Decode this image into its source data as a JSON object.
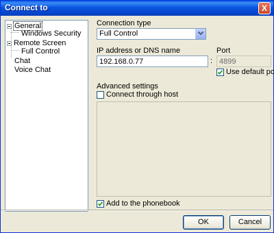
{
  "window": {
    "title": "Connect to",
    "close_glyph": "X"
  },
  "tree": {
    "items": [
      {
        "label": "General",
        "expanded": true,
        "selected": true
      },
      {
        "label": "Windows Security",
        "child": true
      },
      {
        "label": "Remote Screen",
        "expanded": true
      },
      {
        "label": "Full Control",
        "child": true
      },
      {
        "label": "Chat"
      },
      {
        "label": "Voice Chat"
      }
    ]
  },
  "connection": {
    "type_label": "Connection type",
    "type_value": "Full Control",
    "ip_label": "IP address or DNS name",
    "ip_value": "192.168.0.77",
    "port_separator": ":",
    "port_label": "Port",
    "port_value": "4899",
    "use_default_port_label": "Use default port",
    "use_default_port_checked": true
  },
  "advanced": {
    "label": "Advanced settings",
    "connect_through_host_label": "Connect through host",
    "connect_through_host_checked": false
  },
  "phonebook": {
    "label": "Add to the phonebook",
    "checked": true
  },
  "buttons": {
    "ok": "OK",
    "cancel": "Cancel"
  }
}
